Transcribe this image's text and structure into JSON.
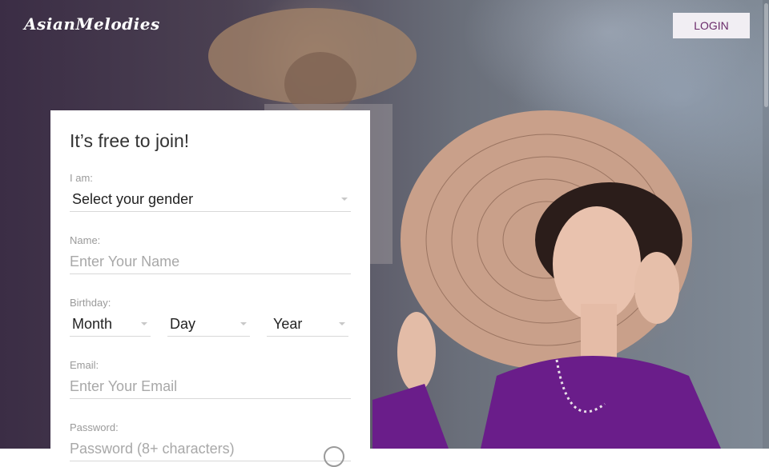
{
  "header": {
    "logo_text": "AsianMelodies",
    "login_label": "LOGIN"
  },
  "form": {
    "title": "It’s free to join!",
    "gender": {
      "label": "I am:",
      "value": "Select your gender"
    },
    "name": {
      "label": "Name:",
      "placeholder": "Enter Your Name"
    },
    "birthday": {
      "label": "Birthday:",
      "month": "Month",
      "day": "Day",
      "year": "Year"
    },
    "email": {
      "label": "Email:",
      "placeholder": "Enter Your Email"
    },
    "password": {
      "label": "Password:",
      "placeholder": "Password (8+ characters)"
    }
  },
  "colors": {
    "login_text": "#6a2a6a",
    "card_bg": "#ffffff"
  }
}
